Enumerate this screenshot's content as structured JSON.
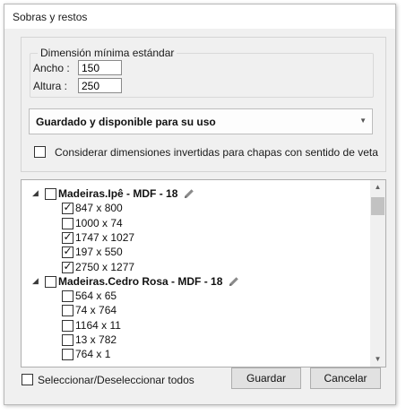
{
  "window": {
    "title": "Sobras y restos"
  },
  "dimensions": {
    "legend": "Dimensión mínima estándar",
    "width_label": "Ancho :",
    "width_value": "150",
    "height_label": "Altura :",
    "height_value": "250"
  },
  "status_combo": {
    "selected": "Guardado y disponible para su uso"
  },
  "invert_option": {
    "label": "Considerar dimensiones invertidas para chapas con sentido de veta",
    "checked": false
  },
  "tree": {
    "groups": [
      {
        "label": "Madeiras.Ipê - MDF - 18",
        "checked": false,
        "items": [
          {
            "label": "847 x 800",
            "checked": true
          },
          {
            "label": "1000 x 74",
            "checked": false
          },
          {
            "label": "1747 x 1027",
            "checked": true
          },
          {
            "label": "197 x 550",
            "checked": true
          },
          {
            "label": "2750 x 1277",
            "checked": true
          }
        ]
      },
      {
        "label": "Madeiras.Cedro Rosa - MDF - 18",
        "checked": false,
        "items": [
          {
            "label": "564 x 65",
            "checked": false
          },
          {
            "label": "74 x 764",
            "checked": false
          },
          {
            "label": "1164 x 11",
            "checked": false
          },
          {
            "label": "13 x 782",
            "checked": false
          },
          {
            "label": "764 x 1",
            "checked": false
          }
        ]
      }
    ]
  },
  "footer": {
    "select_all_label": "Seleccionar/Deseleccionar todos",
    "save_label": "Guardar",
    "cancel_label": "Cancelar"
  },
  "icons": {
    "expander": "triangle-expanded-icon",
    "edit": "pencil-icon"
  }
}
